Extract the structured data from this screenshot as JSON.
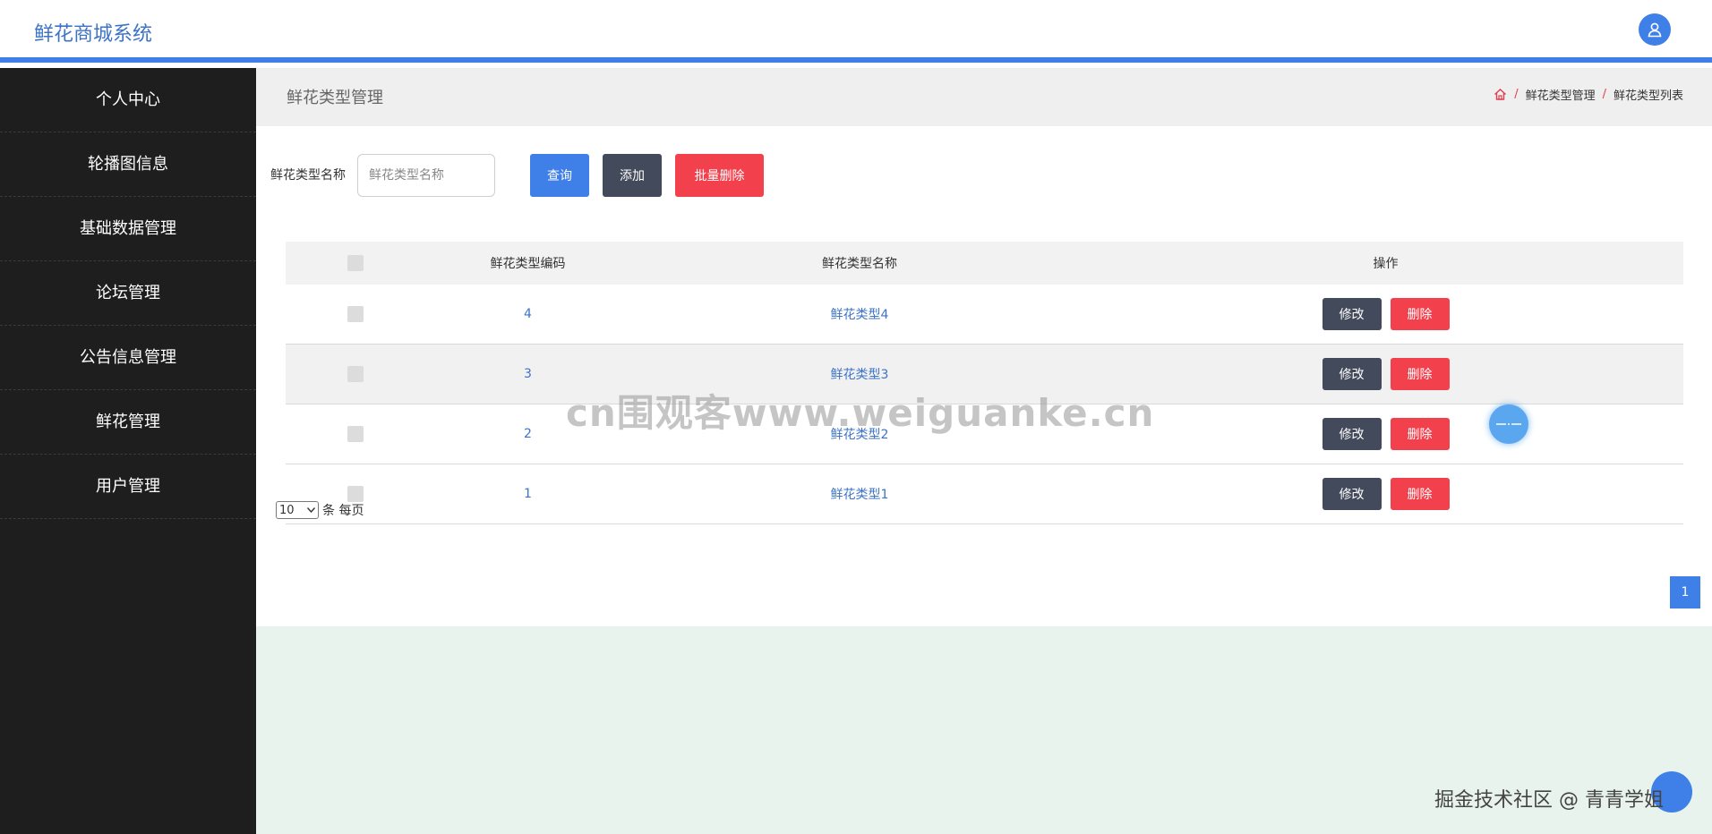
{
  "app": {
    "title": "鲜花商城系统"
  },
  "sidebar": {
    "items": [
      {
        "label": "个人中心"
      },
      {
        "label": "轮播图信息"
      },
      {
        "label": "基础数据管理"
      },
      {
        "label": "论坛管理"
      },
      {
        "label": "公告信息管理"
      },
      {
        "label": "鲜花管理"
      },
      {
        "label": "用户管理"
      }
    ]
  },
  "header": {
    "title": "鲜花类型管理",
    "breadcrumb": [
      "鲜花类型管理",
      "鲜花类型列表"
    ],
    "breadcrumb_sep": "/"
  },
  "filter": {
    "label": "鲜花类型名称",
    "placeholder": "鲜花类型名称",
    "query_label": "查询",
    "add_label": "添加",
    "bulk_delete_label": "批量删除"
  },
  "table": {
    "columns": [
      "鲜花类型编码",
      "鲜花类型名称",
      "操作"
    ],
    "edit_label": "修改",
    "delete_label": "删除",
    "rows": [
      {
        "code": "4",
        "name": "鲜花类型4"
      },
      {
        "code": "3",
        "name": "鲜花类型3"
      },
      {
        "code": "2",
        "name": "鲜花类型2"
      },
      {
        "code": "1",
        "name": "鲜花类型1"
      }
    ]
  },
  "pagination": {
    "page_size": "10",
    "page_size_suffix": "条 每页",
    "current_page": "1"
  },
  "overlay": {
    "watermark": "cn围观客www.weiguanke.cn",
    "credit": "掘金技术社区 @ 青青学姐"
  },
  "colors": {
    "accent": "#3f7fe8",
    "danger": "#f2404c",
    "dark_button": "#434a5b",
    "sidebar_bg": "#1e1e1e"
  }
}
